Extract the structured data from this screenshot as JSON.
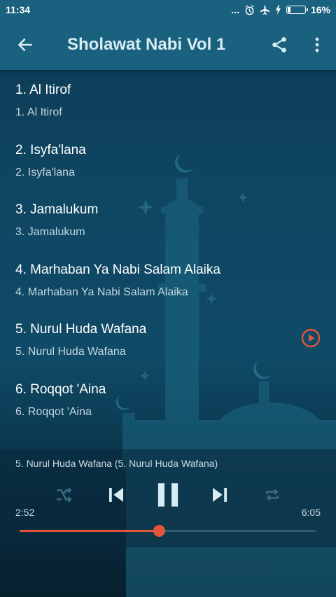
{
  "status_bar": {
    "time": "11:34",
    "more": "...",
    "battery": "16%",
    "battery_level": 0.16
  },
  "app_bar": {
    "title": "Sholawat Nabi Vol 1",
    "back_icon": "arrow-left-icon",
    "share_icon": "share-icon",
    "menu_icon": "more-vert-icon"
  },
  "tracks": [
    {
      "title": "1. Al Itirof",
      "subtitle": "1. Al Itirof"
    },
    {
      "title": "2. Isyfa'lana",
      "subtitle": "2. Isyfa'lana"
    },
    {
      "title": "3. Jamalukum",
      "subtitle": "3. Jamalukum"
    },
    {
      "title": "4. Marhaban Ya Nabi Salam Alaika",
      "subtitle": "4. Marhaban Ya Nabi Salam Alaika"
    },
    {
      "title": "5. Nurul Huda Wafana",
      "subtitle": "5. Nurul Huda Wafana"
    },
    {
      "title": "6. Roqqot 'Aina",
      "subtitle": "6. Roqqot 'Aina"
    }
  ],
  "player": {
    "now_playing": "5. Nurul Huda Wafana (5. Nurul Huda Wafana)",
    "elapsed": "2:52",
    "duration": "6:05",
    "progress": 0.47,
    "playing_index": 4
  },
  "colors": {
    "accent": "#e2553a",
    "bar": "#19617e"
  }
}
